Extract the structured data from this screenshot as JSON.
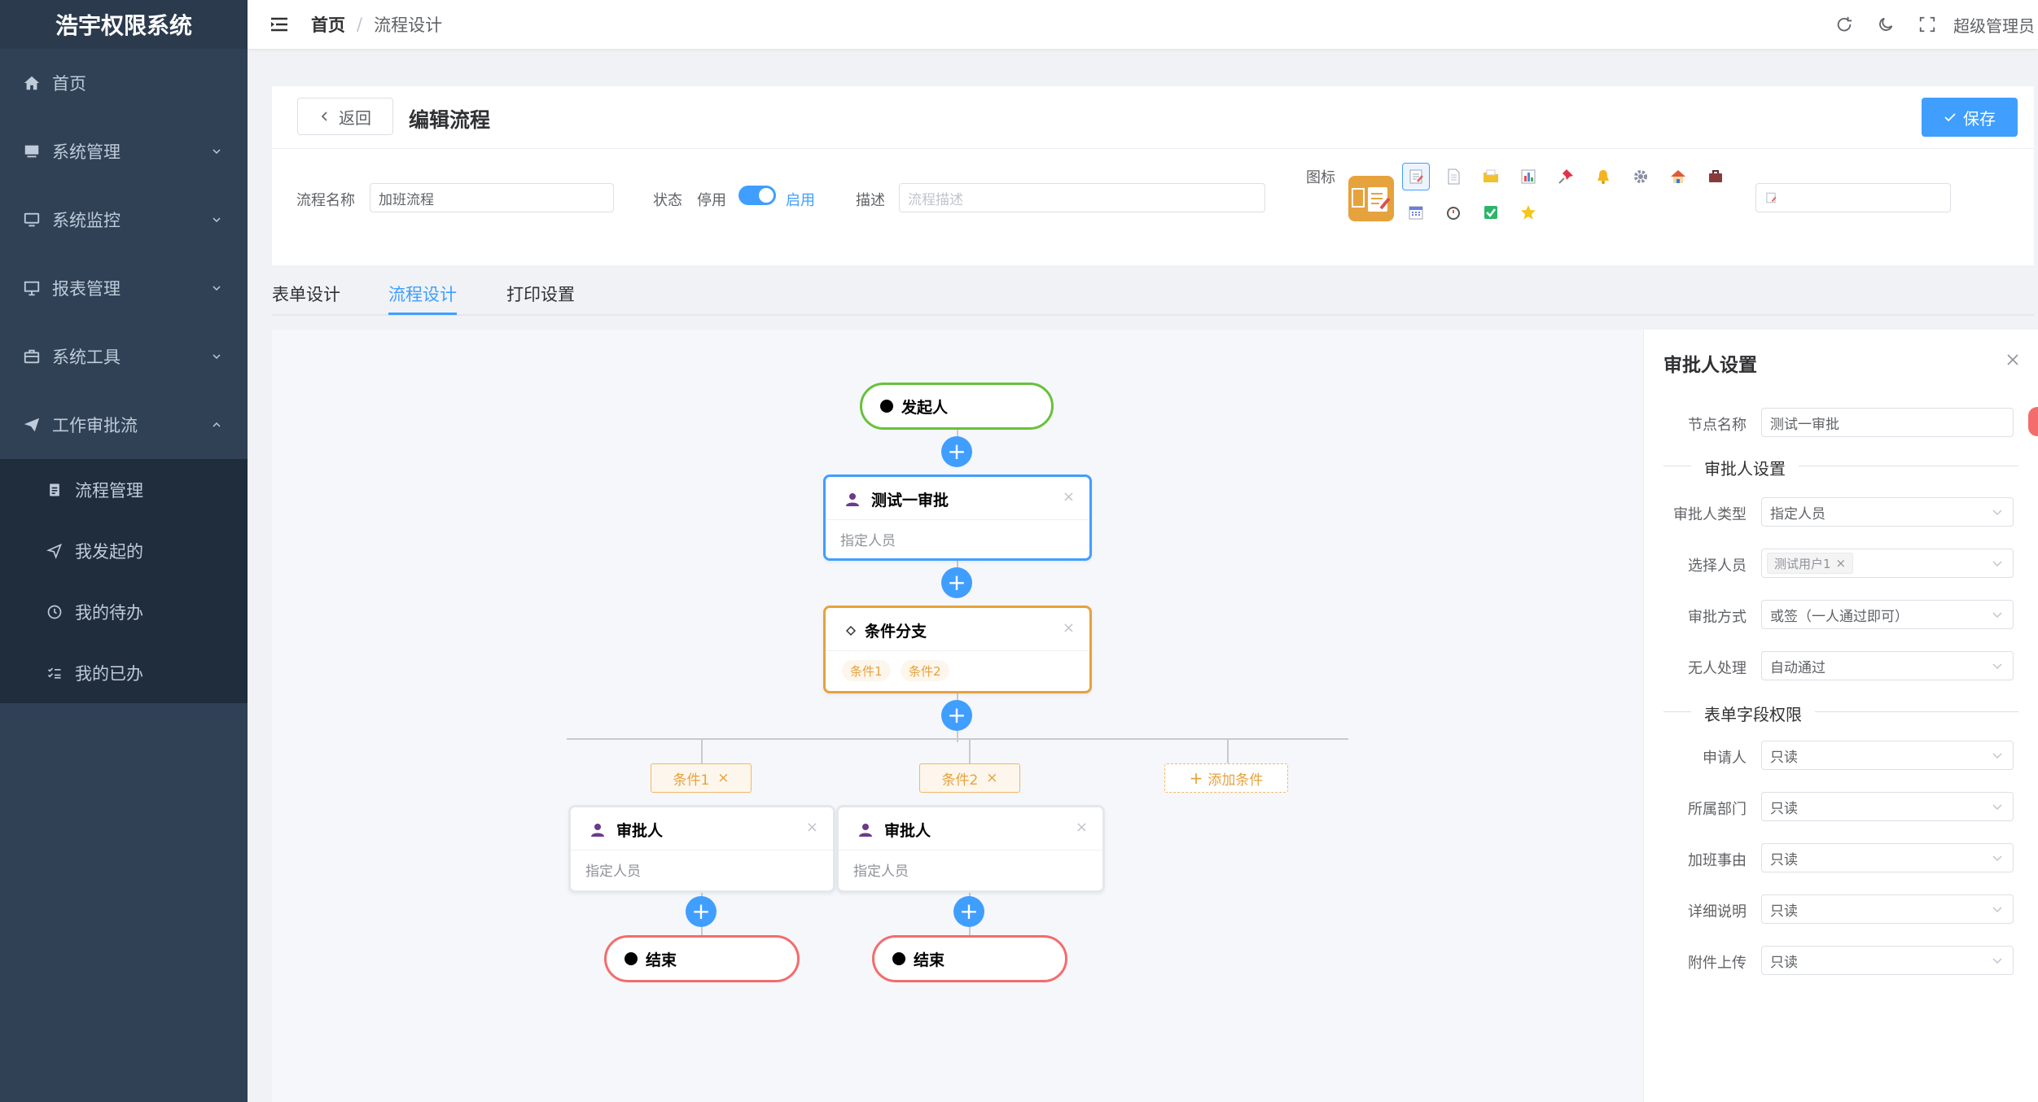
{
  "app": {
    "title": "浩宇权限系统"
  },
  "colors": {
    "primary": "#409eff",
    "sidebar_bg": "#304156",
    "start_border": "#67c23a",
    "approver_border": "#409eff",
    "branch_border": "#e6a23c",
    "end_border": "#f56c6c"
  },
  "sidebar": {
    "items": [
      {
        "label": "首页",
        "icon": "home-icon"
      },
      {
        "label": "系统管理",
        "icon": "monitor-icon"
      },
      {
        "label": "系统监控",
        "icon": "desktop-icon"
      },
      {
        "label": "报表管理",
        "icon": "presentation-icon"
      },
      {
        "label": "系统工具",
        "icon": "toolbox-icon"
      },
      {
        "label": "工作审批流",
        "icon": "send-icon"
      }
    ],
    "sub_items": [
      {
        "label": "流程管理",
        "icon": "clipboard-icon"
      },
      {
        "label": "我发起的",
        "icon": "paper-plane-icon"
      },
      {
        "label": "我的待办",
        "icon": "clock-icon"
      },
      {
        "label": "我的已办",
        "icon": "checklist-icon"
      }
    ]
  },
  "navbar": {
    "breadcrumb": [
      "首页",
      "流程设计"
    ],
    "separator": "/",
    "user": "超级管理员",
    "icons": [
      "refresh-icon",
      "moon-icon",
      "fullscreen-icon"
    ]
  },
  "editor": {
    "back_label": "返回",
    "title": "编辑流程",
    "save_label": "保存",
    "form": {
      "name_label": "流程名称",
      "name_value": "加班流程",
      "status_label": "状态",
      "status_off": "停用",
      "status_on": "启用",
      "desc_label": "描述",
      "desc_placeholder": "流程描述",
      "icon_label": "图标"
    },
    "icon_options": [
      "memo-icon",
      "page-icon",
      "folder-icon",
      "bar-chart-icon",
      "pushpin-icon",
      "bell-icon",
      "gear-icon",
      "house-icon",
      "briefcase-icon",
      "calendar-icon",
      "stopwatch-icon",
      "checkbox-icon",
      "star-icon"
    ]
  },
  "tabs": [
    {
      "label": "表单设计",
      "active": false
    },
    {
      "label": "流程设计",
      "active": true
    },
    {
      "label": "打印设置",
      "active": false
    }
  ],
  "flow": {
    "start_label": "发起人",
    "approver_title": "测试一审批",
    "approver_sub": "指定人员",
    "branch_title": "条件分支",
    "branch_tags": [
      "条件1",
      "条件2"
    ],
    "conditions": [
      "条件1",
      "条件2"
    ],
    "add_condition": "添加条件",
    "branch_approver_title": "审批人",
    "branch_approver_sub": "指定人员",
    "end_label": "结束",
    "close_glyph": "×",
    "plus_glyph": "+"
  },
  "panel": {
    "title": "审批人设置",
    "node_name_label": "节点名称",
    "node_name_value": "测试一审批",
    "section_approver": "审批人设置",
    "fields": [
      {
        "label": "审批人类型",
        "value": "指定人员"
      },
      {
        "label": "选择人员",
        "value": "测试用户1"
      },
      {
        "label": "审批方式",
        "value": "或签（一人通过即可）"
      },
      {
        "label": "无人处理",
        "value": "自动通过"
      }
    ],
    "section_permissions": "表单字段权限",
    "permissions": [
      {
        "label": "申请人",
        "value": "只读"
      },
      {
        "label": "所属部门",
        "value": "只读"
      },
      {
        "label": "加班事由",
        "value": "只读"
      },
      {
        "label": "详细说明",
        "value": "只读"
      },
      {
        "label": "附件上传",
        "value": "只读"
      }
    ]
  }
}
